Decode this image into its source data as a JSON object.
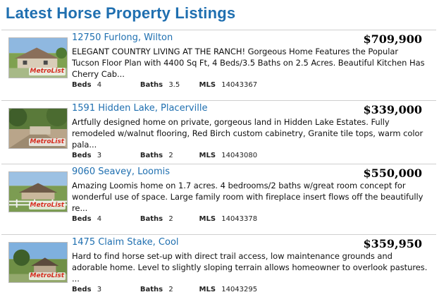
{
  "heading": "Latest Horse Property Listings",
  "badge_text": "MetroList",
  "labels": {
    "beds": "Beds",
    "baths": "Baths",
    "mls": "MLS"
  },
  "listings": [
    {
      "title": "12750 Furlong, Wilton",
      "price": "$709,900",
      "description": "ELEGANT COUNTRY LIVING AT THE RANCH! Gorgeous Home Features the Popular Tucson Floor Plan with 4400 Sq Ft, 4 Beds/3.5 Baths on 2.5 Acres. Beautiful Kitchen Has Cherry Cab...",
      "beds": "4",
      "baths": "3.5",
      "mls": "14043367"
    },
    {
      "title": "1591 Hidden Lake, Placerville",
      "price": "$339,000",
      "description": "Artfully designed home on private, gorgeous land in Hidden Lake Estates. Fully remodeled w/walnut flooring, Red Birch custom cabinetry, Granite tile tops, warm color pala...",
      "beds": "3",
      "baths": "2",
      "mls": "14043080"
    },
    {
      "title": "9060 Seavey, Loomis",
      "price": "$550,000",
      "description": "Amazing Loomis home on 1.7 acres. 4 bedrooms/2 baths w/great room concept for wonderful use of space. Large family room with fireplace insert flows off the beautifully re...",
      "beds": "4",
      "baths": "2",
      "mls": "14043378"
    },
    {
      "title": "1475 Claim Stake, Cool",
      "price": "$359,950",
      "description": "Hard to find horse set-up with direct trail access, low maintenance grounds and adorable home. Level to slightly sloping terrain allows homeowner to overlook pastures. ...",
      "beds": "3",
      "baths": "2",
      "mls": "14043295"
    }
  ]
}
